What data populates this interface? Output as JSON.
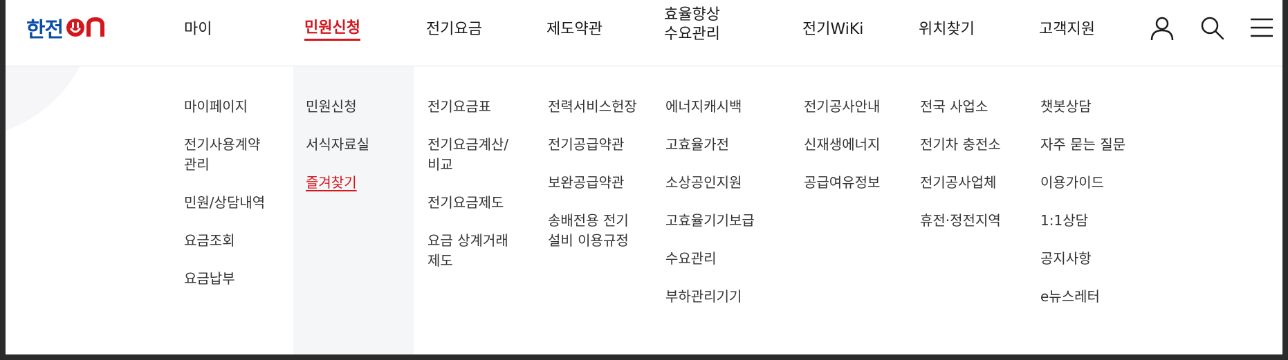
{
  "brand": {
    "name": "한전",
    "accent_color": "#d4161d",
    "brand_color": "#0a4ea8"
  },
  "nav": [
    {
      "label": "마이"
    },
    {
      "label": "민원신청",
      "active": true
    },
    {
      "label": "전기요금"
    },
    {
      "label": "제도약관"
    },
    {
      "label_line1": "효율향상",
      "label_line2": "수요관리"
    },
    {
      "label": "전기WiKi"
    },
    {
      "label": "위치찾기"
    },
    {
      "label": "고객지원"
    }
  ],
  "header_icons": [
    "user-icon",
    "search-icon",
    "menu-icon"
  ],
  "menu": {
    "col1": {
      "items": [
        "마이페이지",
        "전기사용계약\n관리",
        "민원/상담내역",
        "요금조회",
        "요금납부"
      ]
    },
    "col2": {
      "items": [
        "민원신청",
        "서식자료실",
        "즐겨찾기"
      ],
      "active_index": 2
    },
    "col3": {
      "items": [
        "전기요금표",
        "전기요금계산/\n비교",
        "전기요금제도",
        "요금 상계거래\n제도"
      ]
    },
    "col4": {
      "items": [
        "전력서비스헌장",
        "전기공급약관",
        "보완공급약관",
        "송배전용 전기\n설비 이용규정"
      ]
    },
    "col5": {
      "items": [
        "에너지캐시백",
        "고효율가전",
        "소상공인지원",
        "고효율기기보급",
        "수요관리",
        "부하관리기기"
      ]
    },
    "col6": {
      "items": [
        "전기공사안내",
        "신재생에너지",
        "공급여유정보"
      ]
    },
    "col7": {
      "items": [
        "전국 사업소",
        "전기차 충전소",
        "전기공사업체",
        "휴전·정전지역"
      ]
    },
    "col8": {
      "items": [
        "챗봇상담",
        "자주 묻는 질문",
        "이용가이드",
        "1:1상담",
        "공지사항",
        "e뉴스레터"
      ]
    }
  }
}
